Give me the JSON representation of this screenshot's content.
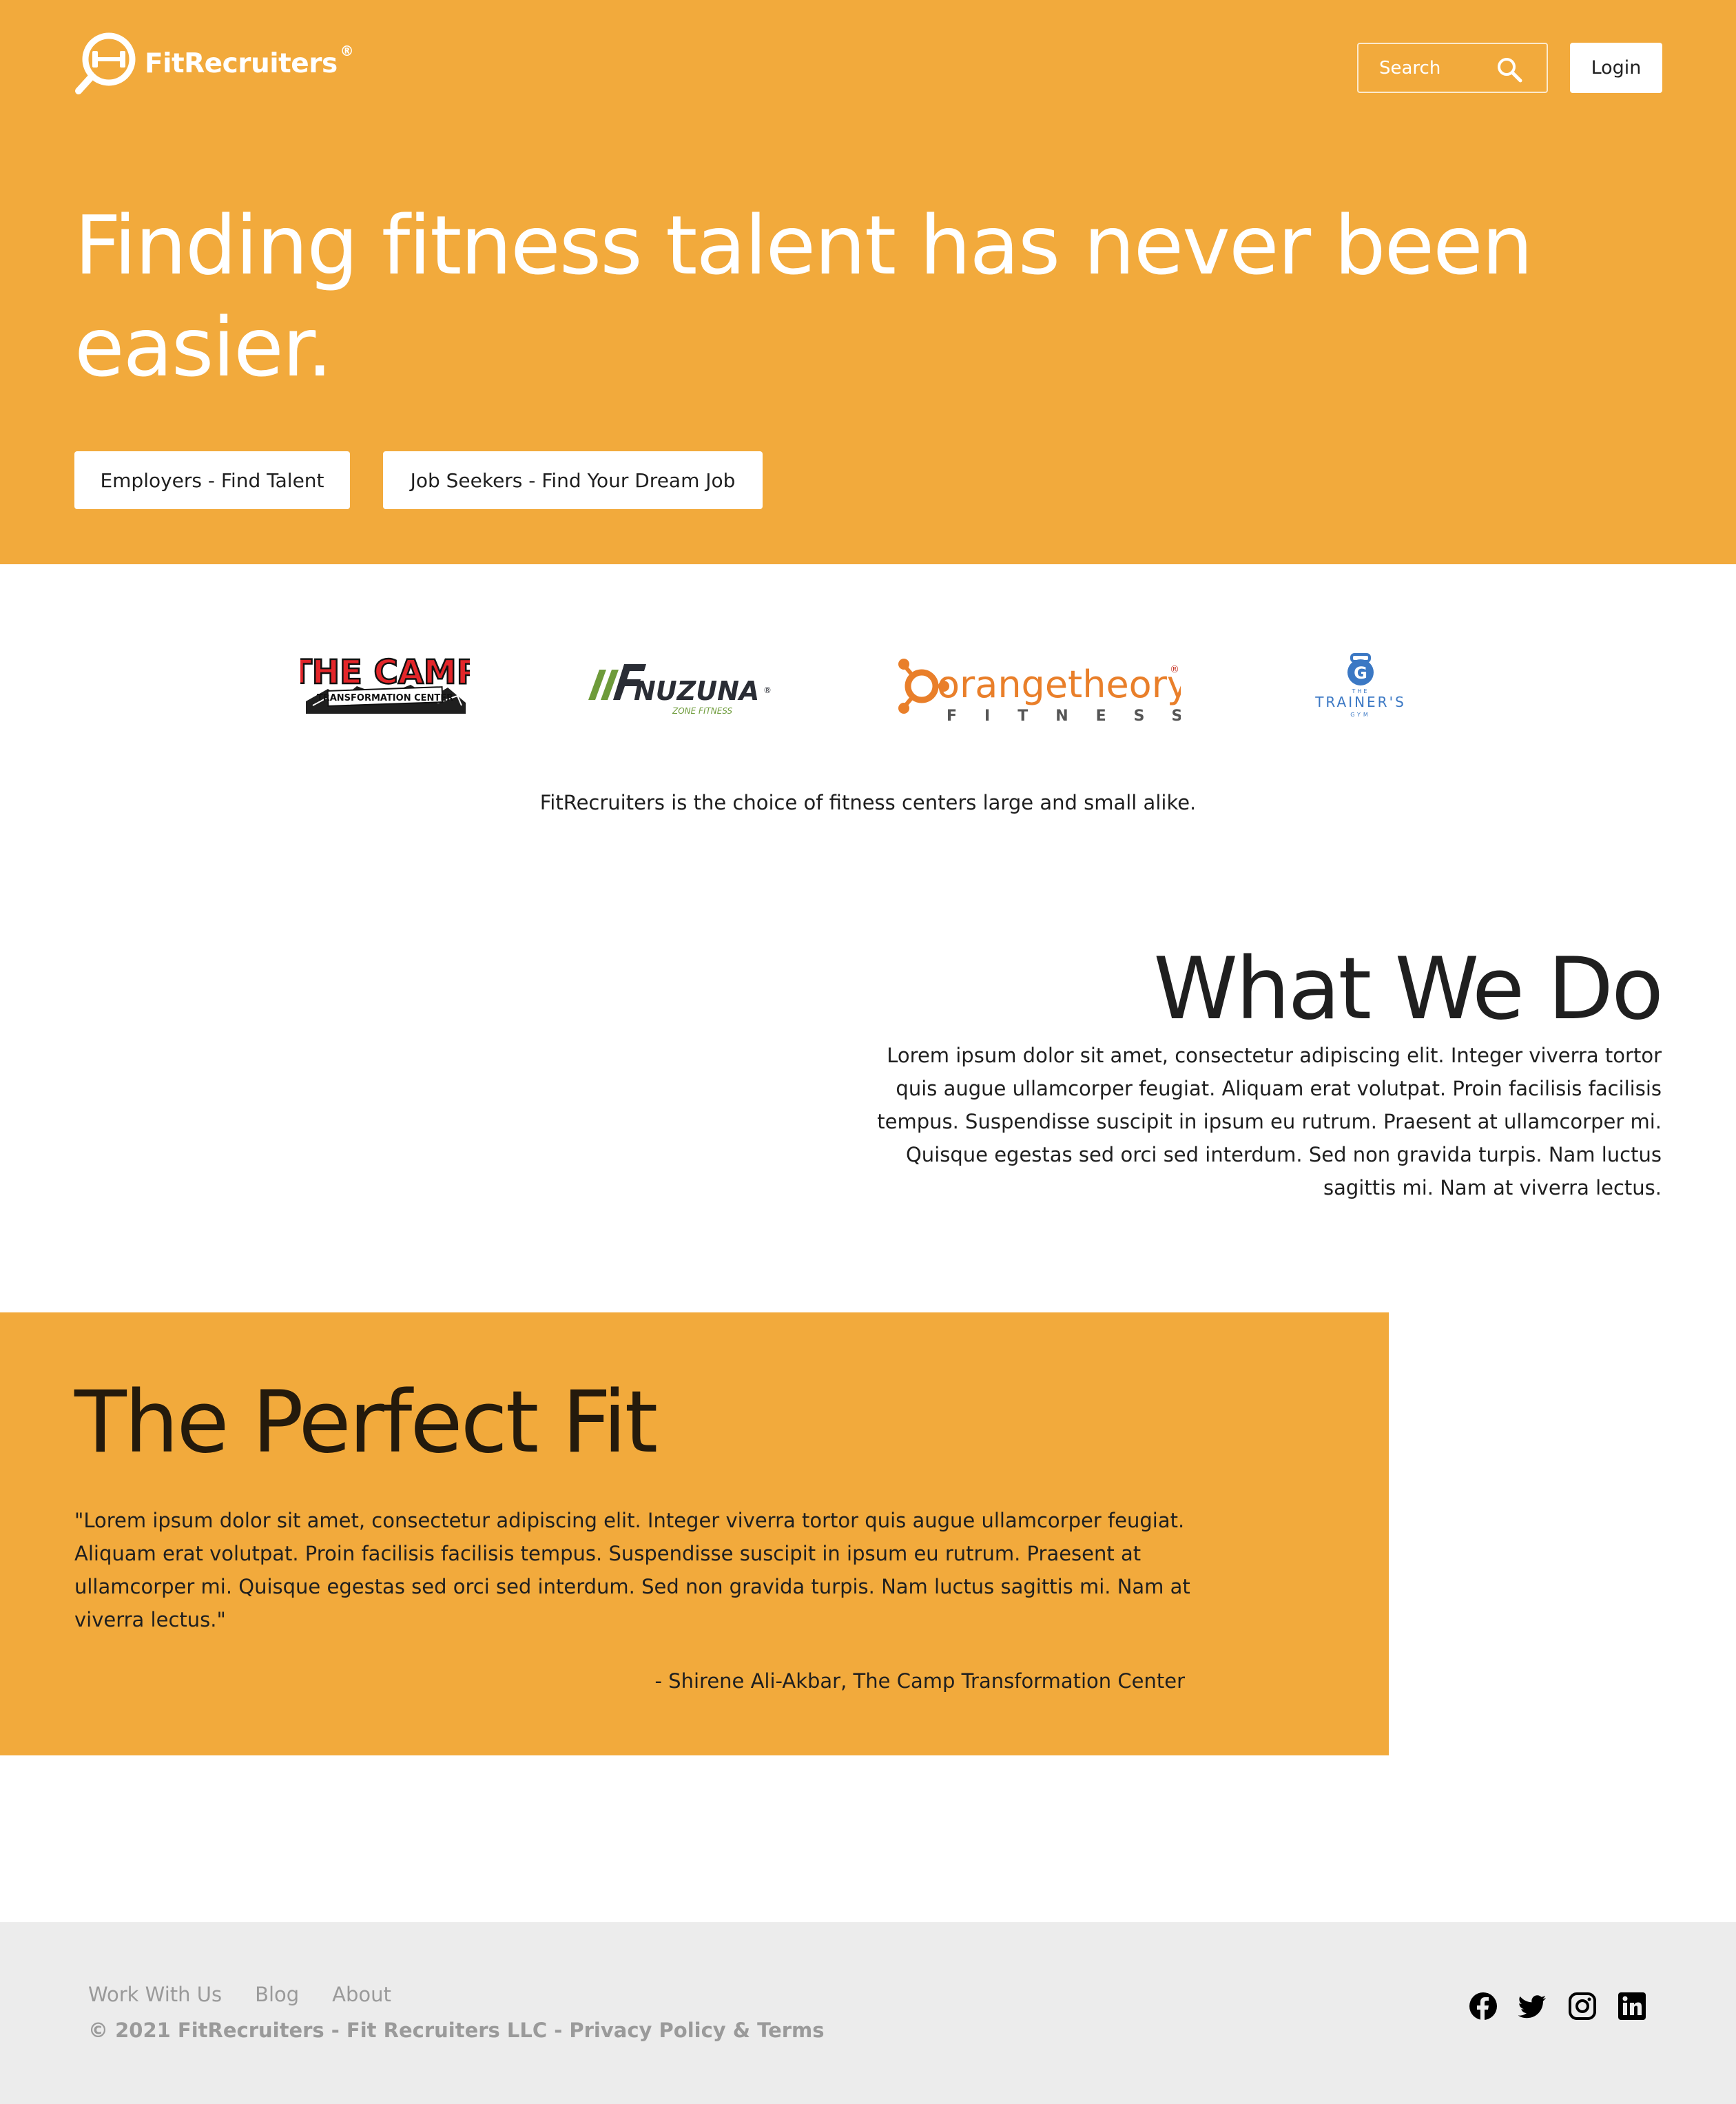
{
  "header": {
    "brand": "FitRecruiters",
    "brand_mark": "®",
    "search_placeholder": "Search",
    "login_label": "Login"
  },
  "hero": {
    "title": "Finding fitness talent has never been easier.",
    "employers_button": "Employers - Find Talent",
    "seekers_button": "Job Seekers - Find Your Dream Job"
  },
  "partners": {
    "logos": [
      {
        "name": "the-camp-logo",
        "text": "THE CAMP",
        "subtext": "TRANSFORMATION CENTER"
      },
      {
        "name": "nuzuna-logo",
        "text": "NUZUNA",
        "subtext": "ZONE FITNESS"
      },
      {
        "name": "orangetheory-logo",
        "text": "orangetheory",
        "subtext": "FITNESS"
      },
      {
        "name": "trainers-gym-logo",
        "text": "TRAINER'S",
        "subtext": "GYM"
      }
    ],
    "tagline": "FitRecruiters is the choice of fitness centers large and small alike."
  },
  "what_we_do": {
    "title": "What We Do",
    "body": "Lorem ipsum dolor sit amet, consectetur adipiscing elit. Integer viverra tortor quis augue ullamcorper feugiat. Aliquam erat volutpat. Proin facilisis facilisis tempus. Suspendisse suscipit in ipsum eu rutrum. Praesent at ullamcorper mi. Quisque egestas sed orci sed interdum. Sed non gravida turpis. Nam luctus sagittis mi. Nam at viverra lectus."
  },
  "perfect_fit": {
    "title": "The Perfect Fit",
    "quote": "\"Lorem ipsum dolor sit amet, consectetur adipiscing elit. Integer viverra tortor quis augue ullamcorper feugiat. Aliquam erat volutpat. Proin facilisis facilisis tempus. Suspendisse suscipit in ipsum eu rutrum. Praesent at ullamcorper mi. Quisque egestas sed orci sed interdum. Sed non gravida turpis. Nam luctus sagittis mi. Nam at viverra lectus.\"",
    "author": "- Shirene Ali-Akbar, The Camp Transformation Center"
  },
  "footer": {
    "links": [
      "Work With Us",
      "Blog",
      "About"
    ],
    "copyright": "© 2021 FitRecruiters - Fit Recruiters LLC - Privacy Policy & Terms",
    "social_icons": [
      "facebook-icon",
      "twitter-icon",
      "instagram-icon",
      "linkedin-icon"
    ]
  },
  "colors": {
    "accent": "#f2aa3c",
    "text": "#1f1f1f",
    "footer_bg": "#ececec",
    "footer_text": "#9a9a9a",
    "orangetheory": "#e97f2a"
  }
}
